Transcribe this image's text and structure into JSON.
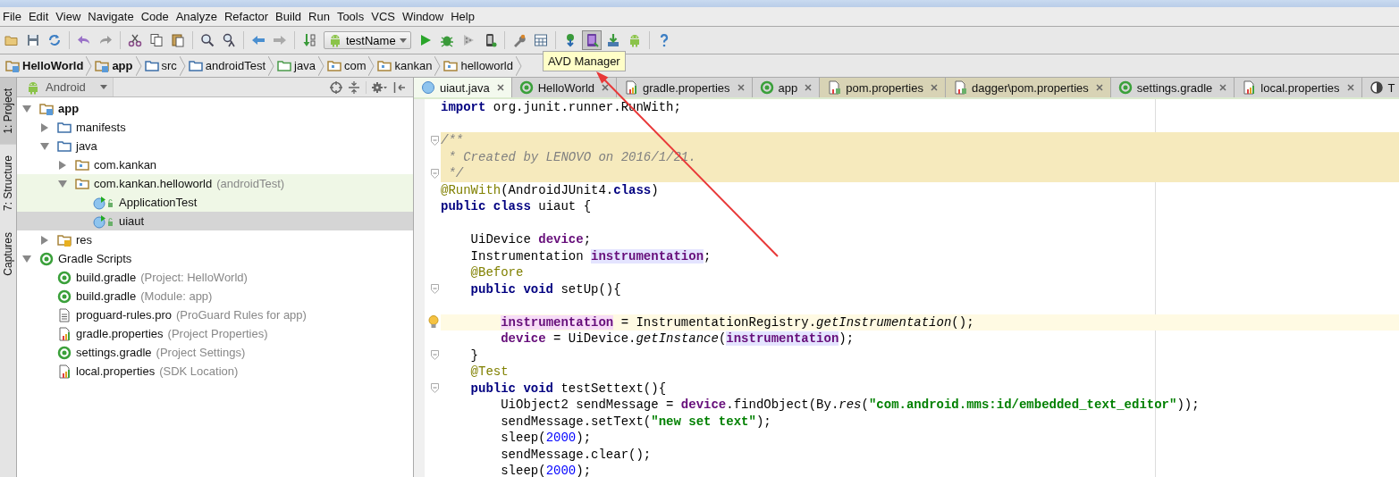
{
  "menu": [
    "File",
    "Edit",
    "View",
    "Navigate",
    "Code",
    "Analyze",
    "Refactor",
    "Build",
    "Run",
    "Tools",
    "VCS",
    "Window",
    "Help"
  ],
  "toolbar": {
    "run_config": "testName"
  },
  "tooltip": {
    "text": "AVD Manager"
  },
  "breadcrumbs": [
    {
      "label": "HelloWorld",
      "kind": "module",
      "bold": true
    },
    {
      "label": "app",
      "kind": "module",
      "bold": true
    },
    {
      "label": "src",
      "kind": "folder",
      "bold": false
    },
    {
      "label": "androidTest",
      "kind": "folder",
      "bold": false
    },
    {
      "label": "java",
      "kind": "source",
      "bold": false
    },
    {
      "label": "com",
      "kind": "package",
      "bold": false
    },
    {
      "label": "kankan",
      "kind": "package",
      "bold": false
    },
    {
      "label": "helloworld",
      "kind": "package",
      "bold": false
    }
  ],
  "tool_strip": [
    {
      "label": "1: Project",
      "selected": true
    },
    {
      "label": "7: Structure",
      "selected": false
    },
    {
      "label": "Captures",
      "selected": false
    }
  ],
  "project_panel": {
    "view": "Android",
    "tree": [
      {
        "label": "app",
        "kind": "module",
        "expanded": true,
        "selected": false,
        "highlighted": false,
        "children": [
          {
            "label": "manifests",
            "kind": "folder",
            "expanded": false,
            "selected": false,
            "highlighted": false
          },
          {
            "label": "java",
            "kind": "folder",
            "expanded": true,
            "selected": false,
            "highlighted": false,
            "children": [
              {
                "label": "com.kankan",
                "kind": "package",
                "expanded": false,
                "selected": false,
                "highlighted": false
              },
              {
                "label": "com.kankan.helloworld",
                "hint": "(androidTest)",
                "kind": "package",
                "expanded": true,
                "selected": false,
                "highlighted": true,
                "children": [
                  {
                    "label": "ApplicationTest",
                    "kind": "test-class",
                    "selected": false,
                    "highlighted": true
                  },
                  {
                    "label": "uiaut",
                    "kind": "test-class",
                    "selected": true,
                    "highlighted": true
                  }
                ]
              }
            ]
          },
          {
            "label": "res",
            "kind": "res",
            "expanded": false,
            "selected": false,
            "highlighted": false
          }
        ]
      },
      {
        "label": "Gradle Scripts",
        "kind": "gradle",
        "expanded": true,
        "selected": false,
        "highlighted": false,
        "children": [
          {
            "label": "build.gradle",
            "hint": "(Project: HelloWorld)",
            "kind": "gradle",
            "selected": false,
            "highlighted": false
          },
          {
            "label": "build.gradle",
            "hint": "(Module: app)",
            "kind": "gradle",
            "selected": false,
            "highlighted": false
          },
          {
            "label": "proguard-rules.pro",
            "hint": "(ProGuard Rules for app)",
            "kind": "file",
            "selected": false,
            "highlighted": false
          },
          {
            "label": "gradle.properties",
            "hint": "(Project Properties)",
            "kind": "properties",
            "selected": false,
            "highlighted": false
          },
          {
            "label": "settings.gradle",
            "hint": "(Project Settings)",
            "kind": "gradle",
            "selected": false,
            "highlighted": false
          },
          {
            "label": "local.properties",
            "hint": "(SDK Location)",
            "kind": "properties",
            "selected": false,
            "highlighted": false
          }
        ]
      }
    ]
  },
  "editor": {
    "tabs": [
      {
        "label": "uiaut.java",
        "kind": "class",
        "selected": true,
        "external": false
      },
      {
        "label": "HelloWorld",
        "kind": "gradle",
        "selected": false,
        "external": false
      },
      {
        "label": "gradle.properties",
        "kind": "properties",
        "selected": false,
        "external": false
      },
      {
        "label": "app",
        "kind": "gradle",
        "selected": false,
        "external": false
      },
      {
        "label": "pom.properties",
        "kind": "properties-lib",
        "selected": false,
        "external": true
      },
      {
        "label": "dagger\\pom.properties",
        "kind": "properties-lib",
        "selected": false,
        "external": true
      },
      {
        "label": "settings.gradle",
        "kind": "gradle",
        "selected": false,
        "external": false
      },
      {
        "label": "local.properties",
        "kind": "properties",
        "selected": false,
        "external": false
      },
      {
        "label": "T",
        "kind": "other",
        "selected": false,
        "external": false
      }
    ],
    "lines": [
      {
        "kind": "code",
        "segs": [
          {
            "kind": "keyword",
            "t": "import"
          },
          {
            "kind": "plain",
            "t": " org.junit.runner.RunWith;"
          }
        ]
      },
      {
        "kind": "code"
      },
      {
        "kind": "doc",
        "fold": true,
        "segs": [
          {
            "kind": "comment",
            "t": "/**"
          }
        ]
      },
      {
        "kind": "doc",
        "segs": [
          {
            "kind": "comment",
            "t": " * Created by LENOVO on 2016/1/21."
          }
        ]
      },
      {
        "kind": "doc",
        "fold": true,
        "segs": [
          {
            "kind": "comment",
            "t": " */"
          }
        ]
      },
      {
        "kind": "code",
        "segs": [
          {
            "kind": "annotation",
            "t": "@RunWith"
          },
          {
            "kind": "plain",
            "t": "(AndroidJUnit4."
          },
          {
            "kind": "keyword",
            "t": "class"
          },
          {
            "kind": "plain",
            "t": ")"
          }
        ]
      },
      {
        "kind": "code",
        "segs": [
          {
            "kind": "keyword",
            "t": "public class"
          },
          {
            "kind": "plain",
            "t": " uiaut {"
          }
        ]
      },
      {
        "kind": "code"
      },
      {
        "kind": "code",
        "segs": [
          {
            "kind": "plain",
            "t": "    UiDevice "
          },
          {
            "kind": "field",
            "t": "device"
          },
          {
            "kind": "plain",
            "t": ";"
          }
        ]
      },
      {
        "kind": "code",
        "segs": [
          {
            "kind": "plain",
            "t": "    Instrumentation "
          },
          {
            "kind": "usage",
            "t": "instrumentation"
          },
          {
            "kind": "plain",
            "t": ";"
          }
        ]
      },
      {
        "kind": "code",
        "segs": [
          {
            "kind": "annotation",
            "t": "    @Before"
          }
        ]
      },
      {
        "kind": "code",
        "fold": true,
        "segs": [
          {
            "kind": "keyword",
            "t": "    public void"
          },
          {
            "kind": "plain",
            "t": " setUp(){"
          }
        ]
      },
      {
        "kind": "code"
      },
      {
        "kind": "caret",
        "bulb": true,
        "segs": [
          {
            "kind": "write",
            "t": "        instrumentation"
          },
          {
            "kind": "plain",
            "t": " = InstrumentationRegistry."
          },
          {
            "kind": "italic",
            "t": "getInstrumentation"
          },
          {
            "kind": "plain",
            "t": "();"
          }
        ]
      },
      {
        "kind": "code",
        "segs": [
          {
            "kind": "field",
            "t": "        device"
          },
          {
            "kind": "plain",
            "t": " = UiDevice."
          },
          {
            "kind": "italic",
            "t": "getInstance"
          },
          {
            "kind": "plain",
            "t": "("
          },
          {
            "kind": "usage",
            "t": "instrumentation"
          },
          {
            "kind": "plain",
            "t": ");"
          }
        ]
      },
      {
        "kind": "code",
        "fold": true,
        "segs": [
          {
            "kind": "plain",
            "t": "    }"
          }
        ]
      },
      {
        "kind": "code",
        "segs": [
          {
            "kind": "annotation",
            "t": "    @Test"
          }
        ]
      },
      {
        "kind": "code",
        "fold": true,
        "segs": [
          {
            "kind": "keyword",
            "t": "    public void"
          },
          {
            "kind": "plain",
            "t": " testSettext(){"
          }
        ]
      },
      {
        "kind": "code",
        "segs": [
          {
            "kind": "plain",
            "t": "        UiObject2 sendMessage = "
          },
          {
            "kind": "field",
            "t": "device"
          },
          {
            "kind": "plain",
            "t": ".findObject(By."
          },
          {
            "kind": "italic",
            "t": "res"
          },
          {
            "kind": "plain",
            "t": "("
          },
          {
            "kind": "string",
            "t": "\"com.android.mms:id/embedded_text_editor\""
          },
          {
            "kind": "plain",
            "t": "));"
          }
        ]
      },
      {
        "kind": "code",
        "segs": [
          {
            "kind": "plain",
            "t": "        sendMessage.setText("
          },
          {
            "kind": "string",
            "t": "\"new set text\""
          },
          {
            "kind": "plain",
            "t": ");"
          }
        ]
      },
      {
        "kind": "code",
        "segs": [
          {
            "kind": "plain",
            "t": "        sleep("
          },
          {
            "kind": "number",
            "t": "2000"
          },
          {
            "kind": "plain",
            "t": ");"
          }
        ]
      },
      {
        "kind": "code",
        "segs": [
          {
            "kind": "plain",
            "t": "        sendMessage.clear();"
          }
        ]
      },
      {
        "kind": "code",
        "segs": [
          {
            "kind": "plain",
            "t": "        sleep("
          },
          {
            "kind": "number",
            "t": "2000"
          },
          {
            "kind": "plain",
            "t": ");"
          }
        ]
      }
    ]
  }
}
